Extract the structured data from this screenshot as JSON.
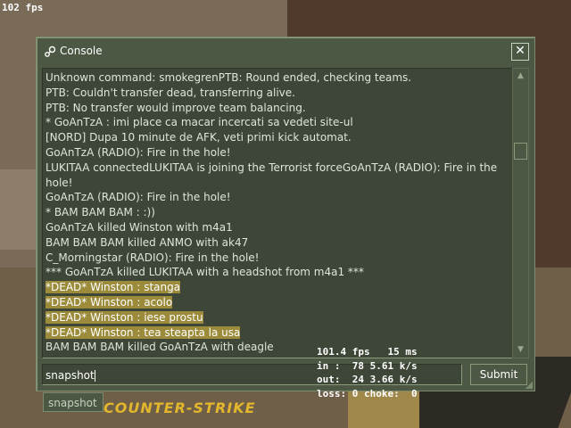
{
  "hud": {
    "fps": "102 fps"
  },
  "console": {
    "title": "Console",
    "log": [
      {
        "text": "Unknown command: smokegrenPTB: Round ended, checking teams.",
        "highlight": false
      },
      {
        "text": "PTB: Couldn't transfer dead, transferring alive.",
        "highlight": false
      },
      {
        "text": "PTB: No transfer would improve team balancing.",
        "highlight": false
      },
      {
        "text": "* GoAnTzA : imi place ca macar incercati sa vedeti site-ul",
        "highlight": false
      },
      {
        "text": "[NORD] Dupa 10 minute de AFK, veti primi kick automat.",
        "highlight": false
      },
      {
        "text": "GoAnTzA (RADIO): Fire in the hole!",
        "highlight": false
      },
      {
        "text": "LUKITAA connectedLUKITAA is joining the Terrorist forceGoAnTzA (RADIO): Fire in the hole!",
        "highlight": false
      },
      {
        "text": "GoAnTzA (RADIO): Fire in the hole!",
        "highlight": false
      },
      {
        "text": "* BAM BAM BAM : :))",
        "highlight": false
      },
      {
        "text": "GoAnTzA killed Winston with m4a1",
        "highlight": false
      },
      {
        "text": "BAM BAM BAM killed ANMO with ak47",
        "highlight": false
      },
      {
        "text": "C_Morningstar (RADIO): Fire in the hole!",
        "highlight": false
      },
      {
        "text": "*** GoAnTzA killed LUKITAA with a headshot from m4a1 ***",
        "highlight": false
      },
      {
        "text": "*DEAD* Winston : stanga",
        "highlight": true
      },
      {
        "text": "*DEAD* Winston : acolo",
        "highlight": true
      },
      {
        "text": "*DEAD* Winston : iese prostu",
        "highlight": true
      },
      {
        "text": "*DEAD* Winston : tea steapta la usa",
        "highlight": true
      },
      {
        "text": "BAM BAM BAM killed GoAnTzA with deagle",
        "highlight": false
      }
    ],
    "input_value": "snapshot",
    "submit_label": "Submit",
    "close_glyph": "✕",
    "scroll_up_glyph": "▲",
    "scroll_down_glyph": "▼"
  },
  "net_stats": {
    "line1": "101.4 fps   15 ms",
    "line2": "in :  78 5.61 k/s",
    "line3": "out:  24 3.66 k/s",
    "line4": "loss: 0 choke:  0"
  },
  "autocomplete": {
    "suggestion": "snapshot"
  },
  "logo": {
    "text": "COUNTER-STRIKE",
    "color": "#e3b72c"
  },
  "colors": {
    "panel": "#4c5844",
    "highlight": "#9b8b3b"
  }
}
